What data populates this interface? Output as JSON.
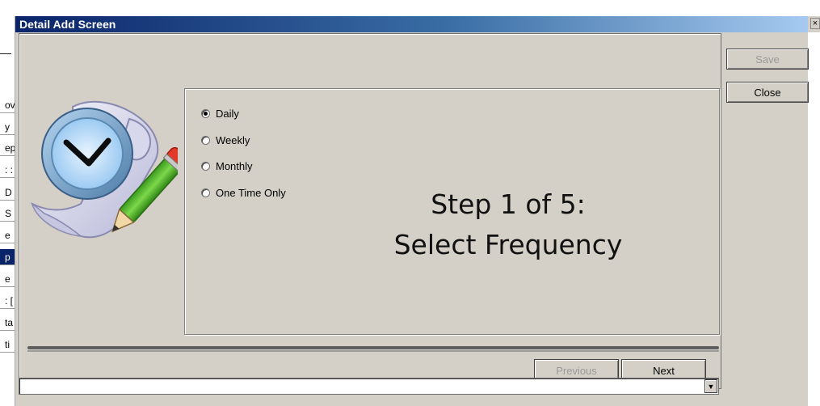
{
  "window": {
    "title": "Detail Add Screen",
    "close_glyph": "×"
  },
  "background_fragments": [
    "ov",
    "y",
    "ep",
    ": :",
    "D",
    "S",
    "e",
    "p",
    "e",
    ": [",
    "ta",
    "ti"
  ],
  "frequency": {
    "options": [
      {
        "label": "Daily",
        "checked": true
      },
      {
        "label": "Weekly",
        "checked": false
      },
      {
        "label": "Monthly",
        "checked": false
      },
      {
        "label": "One Time Only",
        "checked": false
      }
    ]
  },
  "step": {
    "line1": "Step 1 of 5:",
    "line2": "Select Frequency"
  },
  "buttons": {
    "save": "Save",
    "close": "Close",
    "previous": "Previous",
    "next": "Next"
  },
  "combo": {
    "value": "",
    "arrow_glyph": "▼"
  },
  "icons": {
    "wizard": "clock-scroll-pencil-icon"
  }
}
